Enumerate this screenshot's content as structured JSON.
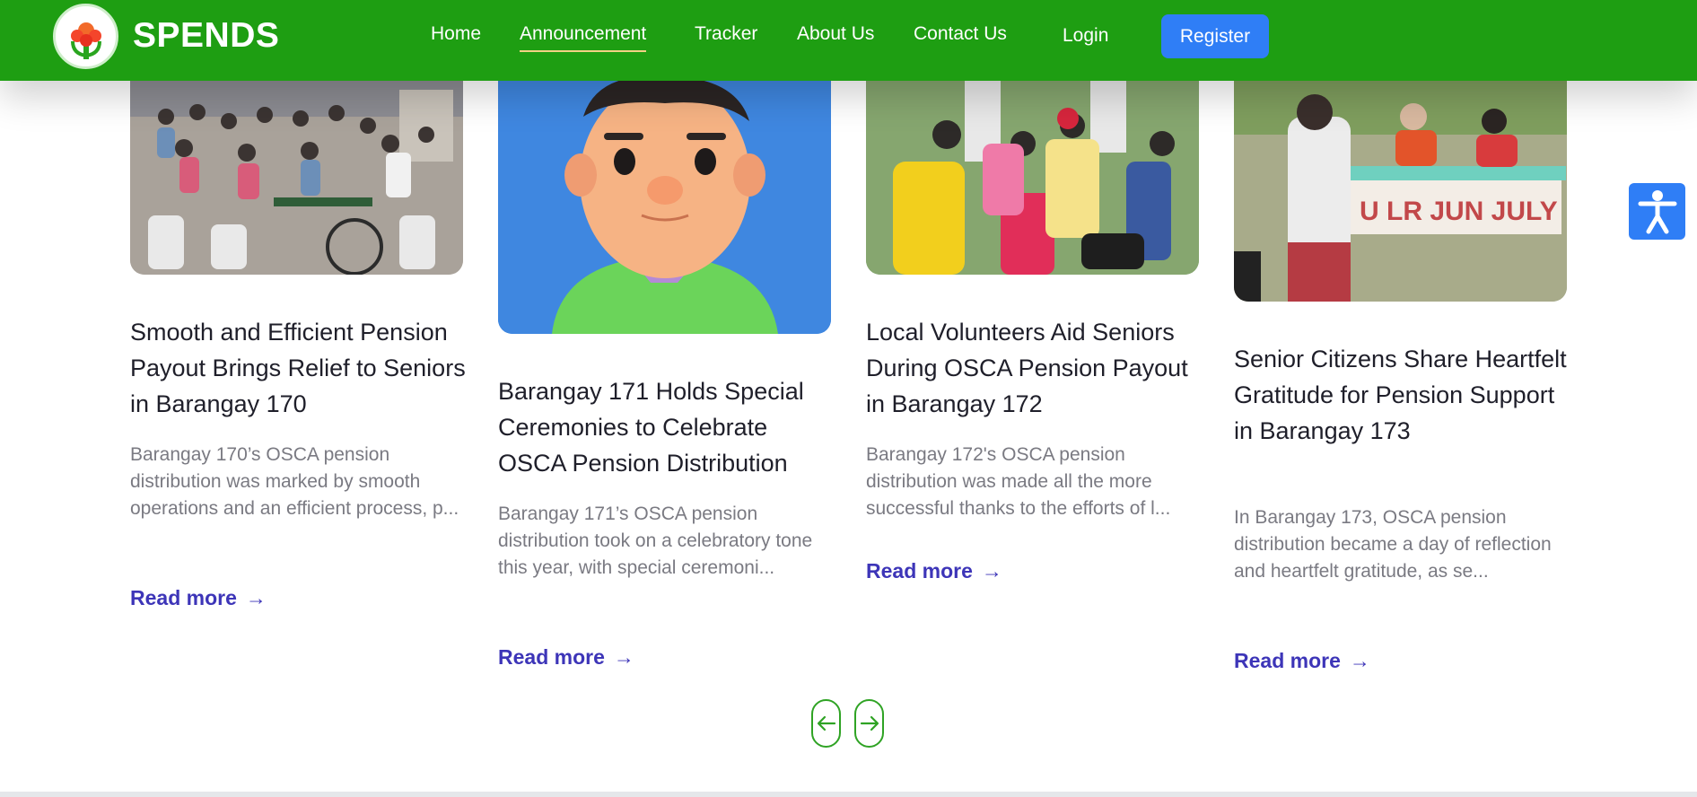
{
  "brand": {
    "name": "SPENDS"
  },
  "nav": {
    "items": [
      {
        "label": "Home"
      },
      {
        "label": "Announcement"
      },
      {
        "label": "Tracker"
      },
      {
        "label": "About Us"
      },
      {
        "label": "Contact Us"
      },
      {
        "label": "Login"
      }
    ],
    "active": "Announcement",
    "register_label": "Register"
  },
  "cards": [
    {
      "title": "Smooth and Efficient Pension Payout Brings Relief to Seniors in Barangay 170",
      "excerpt": "Barangay 170’s OSCA pension distribution was marked by smooth operations and an efficient process, p...",
      "read_more": "Read more"
    },
    {
      "title": "Barangay 171 Holds Special Ceremonies to Celebrate OSCA Pension Distribution",
      "excerpt": "Barangay 171’s OSCA pension distribution took on a celebratory tone this year, with special ceremoni...",
      "read_more": "Read more"
    },
    {
      "title": "Local Volunteers Aid Seniors During OSCA Pension Payout in Barangay 172",
      "excerpt": "Barangay 172's OSCA pension distribution was made all the more successful thanks to the efforts of l...",
      "read_more": "Read more"
    },
    {
      "title": "Senior Citizens Share Heartfelt Gratitude for Pension Support in Barangay 173",
      "excerpt": "In Barangay 173, OSCA pension distribution became a day of reflection and heartfelt gratitude, as se...",
      "read_more": "Read more",
      "banner_text": "U LR JUN JULY"
    }
  ],
  "icons": {
    "read_more_arrow": "arrow-right-icon",
    "prev": "arrow-left-icon",
    "next": "arrow-right-icon",
    "accessibility": "accessibility-icon"
  },
  "colors": {
    "header_green": "#1e9e12",
    "register_blue": "#2f7ef6",
    "link_purple": "#3d35b8",
    "active_underline": "#f2d184"
  }
}
